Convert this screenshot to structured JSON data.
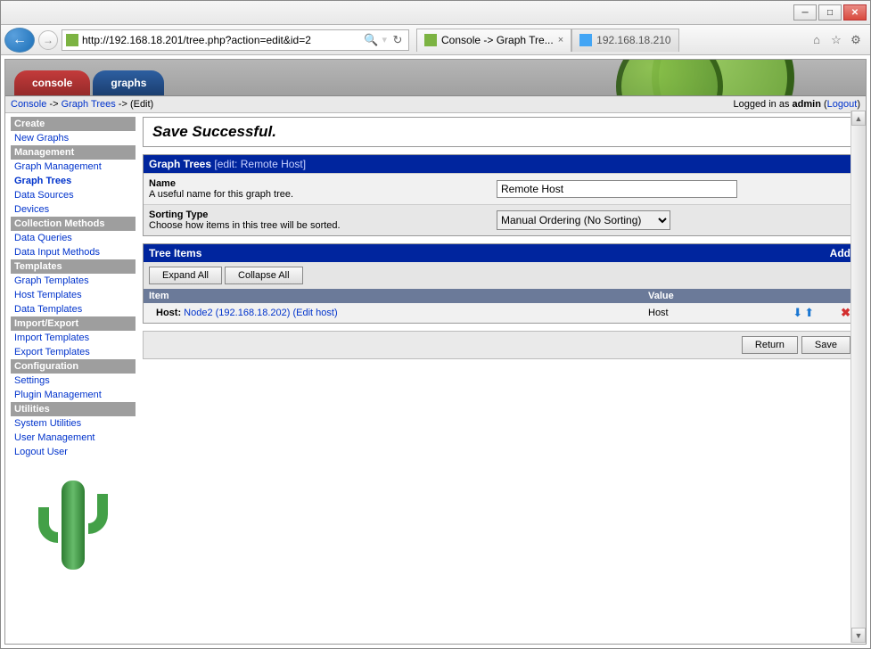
{
  "browser": {
    "url": "http://192.168.18.201/tree.php?action=edit&id=2",
    "tabs": [
      {
        "title": "Console -> Graph Tre...",
        "active": true
      },
      {
        "title": "192.168.18.210",
        "active": false
      }
    ]
  },
  "maintabs": {
    "console": "console",
    "graphs": "graphs"
  },
  "breadcrumb": {
    "console": "Console",
    "graph_trees": "Graph Trees",
    "edit": "(Edit)"
  },
  "login": {
    "text": "Logged in as ",
    "user": "admin",
    "logout": "Logout"
  },
  "sidebar": {
    "sections": [
      {
        "head": "Create",
        "items": [
          "New Graphs"
        ]
      },
      {
        "head": "Management",
        "items": [
          "Graph Management",
          "Graph Trees",
          "Data Sources",
          "Devices"
        ]
      },
      {
        "head": "Collection Methods",
        "items": [
          "Data Queries",
          "Data Input Methods"
        ]
      },
      {
        "head": "Templates",
        "items": [
          "Graph Templates",
          "Host Templates",
          "Data Templates"
        ]
      },
      {
        "head": "Import/Export",
        "items": [
          "Import Templates",
          "Export Templates"
        ]
      },
      {
        "head": "Configuration",
        "items": [
          "Settings",
          "Plugin Management"
        ]
      },
      {
        "head": "Utilities",
        "items": [
          "System Utilities",
          "User Management",
          "Logout User"
        ]
      }
    ],
    "active": "Graph Trees"
  },
  "message": "Save Successful.",
  "graph_trees": {
    "heading": "Graph Trees",
    "edit_tag": "[edit: Remote Host]",
    "name_label": "Name",
    "name_desc": "A useful name for this graph tree.",
    "name_value": "Remote Host",
    "sort_label": "Sorting Type",
    "sort_desc": "Choose how items in this tree will be sorted.",
    "sort_value": "Manual Ordering (No Sorting)"
  },
  "tree_items": {
    "heading": "Tree Items",
    "add_label": "Add",
    "expand": "Expand All",
    "collapse": "Collapse All",
    "col_item": "Item",
    "col_value": "Value",
    "rows": [
      {
        "prefix": "Host:",
        "name": "Node2 (192.168.18.202)",
        "edit": "(Edit host)",
        "value": "Host"
      }
    ]
  },
  "buttons": {
    "return": "Return",
    "save": "Save"
  }
}
